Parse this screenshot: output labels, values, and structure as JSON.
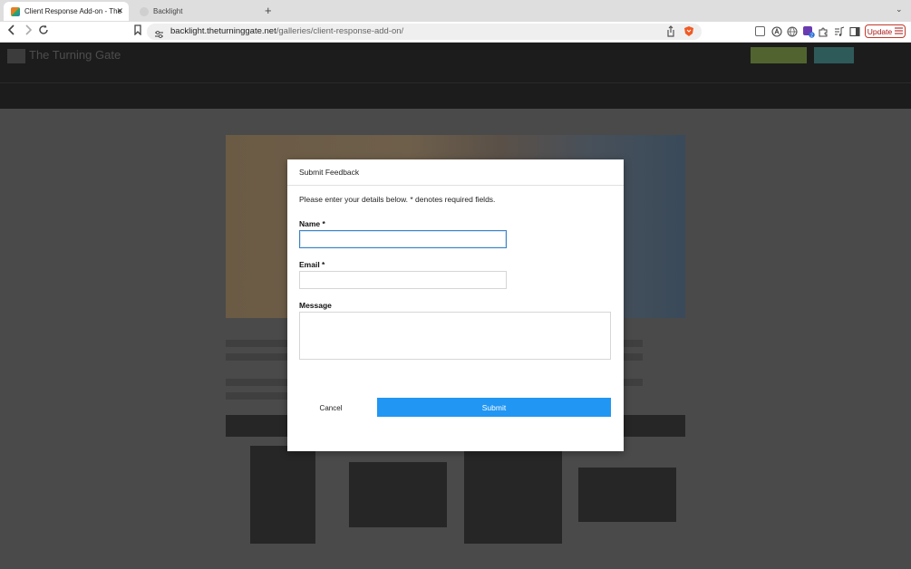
{
  "browser": {
    "tabs": [
      {
        "title": "Client Response Add-on - The",
        "active": true
      },
      {
        "title": "Backlight",
        "active": false
      }
    ],
    "new_tab_symbol": "+",
    "tab_close_symbol": "✕",
    "tab_menu_symbol": "⌄",
    "url": {
      "domain": "backlight.theturninggate.net",
      "path": "/galleries/client-response-add-on/"
    },
    "update_button": "Update",
    "icons": [
      "back-icon",
      "forward-icon",
      "reload-icon",
      "bookmark-icon",
      "site-info-icon",
      "share-icon",
      "brave-shield-icon",
      "extensions-icon",
      "sidebar-icon",
      "menu-icon"
    ]
  },
  "site": {
    "title": "The Turning Gate",
    "colors": {
      "green_button": "#51642f",
      "teal_button": "#2f5a5a"
    }
  },
  "modal": {
    "title": "Submit Feedback",
    "intro": "Please enter your details below. * denotes required fields.",
    "fields": {
      "name": {
        "label": "Name *",
        "value": ""
      },
      "email": {
        "label": "Email *",
        "value": ""
      },
      "message": {
        "label": "Message",
        "value": ""
      }
    },
    "cancel_label": "Cancel",
    "submit_label": "Submit",
    "accent_color": "#2196f3"
  }
}
